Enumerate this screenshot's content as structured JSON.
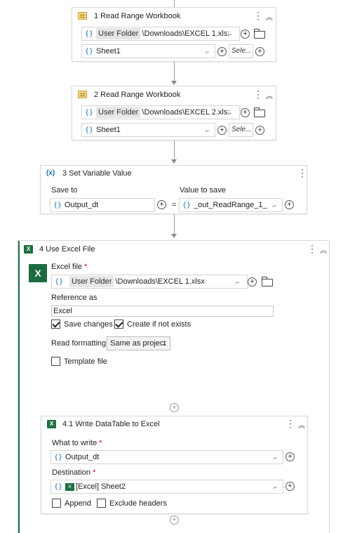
{
  "activity1": {
    "title": "1 Read Range Workbook",
    "path_chip": "User Folder",
    "path_text": "\\Downloads\\EXCEL 1.xls:",
    "sheet": "Sheet1",
    "select_label": "Sele..."
  },
  "activity2": {
    "title": "2 Read Range Workbook",
    "path_chip": "User Folder",
    "path_text": "\\Downloads\\EXCEL 2.xls:",
    "sheet": "Sheet1",
    "select_label": "Sele..."
  },
  "activity3": {
    "title": "3 Set Variable Value",
    "save_to_label": "Save to",
    "value_label": "Value to save",
    "save_to_value": "Output_dt",
    "equals": "=",
    "value_expr": "_out_ReadRange_1__..."
  },
  "activity4": {
    "title": "4 Use Excel File",
    "excel_file_label": "Excel file",
    "required_mark": "*",
    "path_chip": "User Folder",
    "path_text": "\\Downloads\\EXCEL 1.xlsx",
    "reference_label": "Reference as",
    "reference_value": "Excel",
    "save_changes": "Save changes",
    "create_if_not_exists": "Create if not exists",
    "read_formatting_label": "Read formatting",
    "read_formatting_value": "Same as project",
    "template_file": "Template file"
  },
  "activity41": {
    "title": "4.1 Write DataTable to Excel",
    "what_label": "What to write",
    "what_value": "Output_dt",
    "dest_label": "Destination",
    "dest_value": "[Excel] Sheet2",
    "append": "Append",
    "exclude_headers": "Exclude headers",
    "required_mark": "*"
  },
  "states": {
    "save_changes": true,
    "create_if_not_exists": true,
    "template_file": false,
    "append": false,
    "exclude_headers": false
  },
  "icons": {
    "brace": "{}",
    "plus": "+",
    "dots": "⋮",
    "collapse": "︽",
    "expand": "⌐"
  },
  "colors": {
    "excel_green": "#1e7145",
    "variable_blue": "#1a6fb5"
  }
}
